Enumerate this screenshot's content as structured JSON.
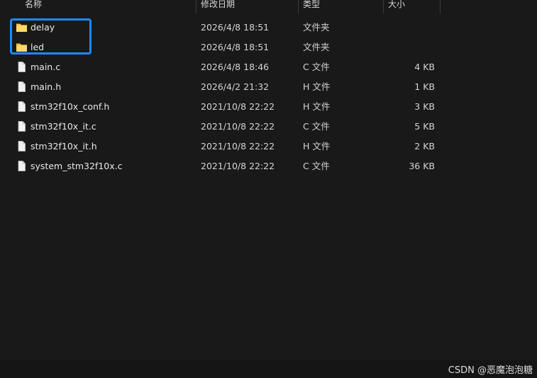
{
  "header": {
    "name": "名称",
    "date_modified": "修改日期",
    "type": "类型",
    "size": "大小"
  },
  "files": [
    {
      "name": "delay",
      "date": "2026/4/8 18:51",
      "type": "文件夹",
      "size": "",
      "icon": "folder-icon"
    },
    {
      "name": "led",
      "date": "2026/4/8 18:51",
      "type": "文件夹",
      "size": "",
      "icon": "folder-icon"
    },
    {
      "name": "main.c",
      "date": "2026/4/8 18:46",
      "type": "C 文件",
      "size": "4 KB",
      "icon": "file-icon"
    },
    {
      "name": "main.h",
      "date": "2026/4/2 21:32",
      "type": "H 文件",
      "size": "1 KB",
      "icon": "file-icon"
    },
    {
      "name": "stm32f10x_conf.h",
      "date": "2021/10/8 22:22",
      "type": "H 文件",
      "size": "3 KB",
      "icon": "file-icon"
    },
    {
      "name": "stm32f10x_it.c",
      "date": "2021/10/8 22:22",
      "type": "C 文件",
      "size": "5 KB",
      "icon": "file-icon"
    },
    {
      "name": "stm32f10x_it.h",
      "date": "2021/10/8 22:22",
      "type": "H 文件",
      "size": "2 KB",
      "icon": "file-icon"
    },
    {
      "name": "system_stm32f10x.c",
      "date": "2021/10/8 22:22",
      "type": "C 文件",
      "size": "36 KB",
      "icon": "file-icon"
    }
  ],
  "colors": {
    "background": "#191919",
    "text": "#e6e6e6",
    "folder": "#f8c143",
    "highlight_border": "#1a8cff"
  },
  "watermark": "CSDN @恶魔泡泡糖"
}
